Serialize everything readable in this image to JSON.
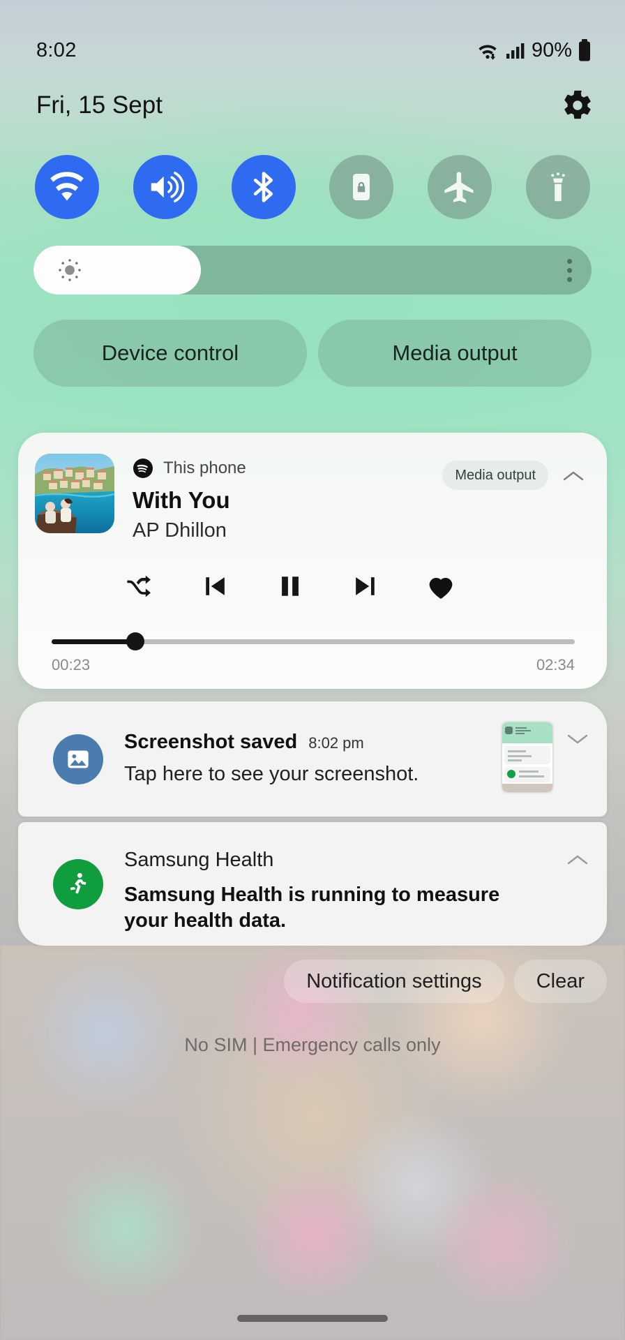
{
  "status_bar": {
    "time": "8:02",
    "battery_percent": "90%",
    "icons": [
      "wifi-data-icon",
      "signal-bars-icon",
      "battery-icon"
    ]
  },
  "header": {
    "date": "Fri, 15 Sept",
    "settings_icon": "gear-icon"
  },
  "quick_toggles": [
    {
      "name": "wifi",
      "icon": "wifi-icon",
      "state": "on"
    },
    {
      "name": "sound",
      "icon": "speaker-icon",
      "state": "on"
    },
    {
      "name": "bluetooth",
      "icon": "bluetooth-icon",
      "state": "on"
    },
    {
      "name": "auto-rotate",
      "icon": "rotation-lock-icon",
      "state": "off"
    },
    {
      "name": "flight-mode",
      "icon": "airplane-icon",
      "state": "off"
    },
    {
      "name": "flashlight",
      "icon": "flashlight-icon",
      "state": "off"
    }
  ],
  "brightness": {
    "icon": "brightness-sun-icon",
    "level_percent": 30,
    "more_icon": "more-vertical-icon"
  },
  "dual_buttons": {
    "device_control": "Device control",
    "media_output": "Media output"
  },
  "media_player": {
    "app_icon": "spotify-icon",
    "app_label": "This phone",
    "track_title": "With You",
    "artist": "AP Dhillon",
    "output_chip": "Media output",
    "collapse_icon": "chevron-up-icon",
    "controls": {
      "shuffle": "shuffle-icon",
      "previous": "skip-previous-icon",
      "play_pause": "pause-icon",
      "next": "skip-next-icon",
      "favorite": "heart-filled-icon"
    },
    "progress_percent": 16,
    "elapsed": "00:23",
    "duration": "02:34"
  },
  "notifications": [
    {
      "app": "screenshot",
      "icon": "image-icon",
      "title": "Screenshot saved",
      "time": "8:02 pm",
      "body": "Tap here to see your screenshot.",
      "expand_icon": "chevron-down-icon",
      "has_thumbnail": true
    },
    {
      "app": "samsung-health",
      "icon": "running-person-icon",
      "title": "Samsung Health",
      "body": "Samsung Health is running to measure your health data.",
      "expand_icon": "chevron-up-icon",
      "has_thumbnail": false
    }
  ],
  "notification_actions": {
    "settings": "Notification settings",
    "clear": "Clear"
  },
  "footer": {
    "sim_status": "No SIM | Emergency calls only"
  },
  "colors": {
    "toggle_on": "#2f6bf0",
    "panel_accent": "#9ee3c3",
    "screenshot_icon_bg": "#4a7caf",
    "health_icon_bg": "#0f9d3e"
  }
}
